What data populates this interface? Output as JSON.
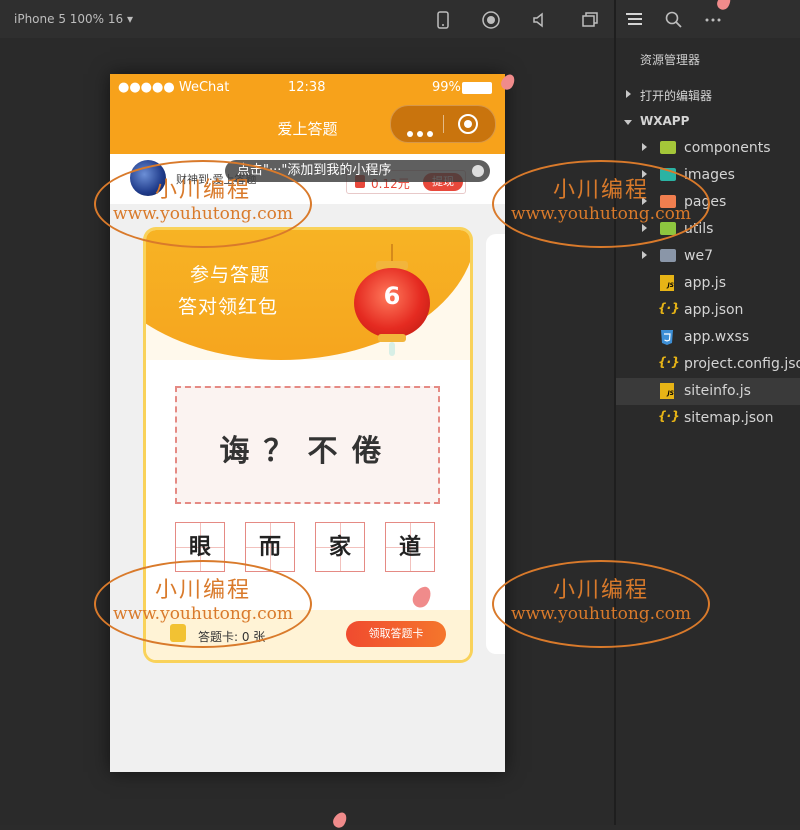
{
  "toolbar": {
    "device_label": "iPhone 5 100% 16 ▾",
    "icons": [
      "phone-icon",
      "record-icon",
      "speaker-icon",
      "window-icon",
      "list-icon",
      "search-icon",
      "more-icon"
    ]
  },
  "phone": {
    "status": {
      "carrier": "●●●●● WeChat",
      "time": "12:38",
      "battery": "99%"
    },
    "nav_title": "爱上答题",
    "add_tip": "点击\"···\"添加到我的小程序",
    "user": {
      "name": "财神到·爱上答题",
      "money": "0.12元",
      "withdraw": "提现"
    },
    "card": {
      "line1": "参与答题",
      "line2": "答对领红包",
      "lantern_number": "6",
      "idiom": "诲？不倦",
      "choices": [
        "眼",
        "而",
        "家",
        "道"
      ],
      "ticket_label": "答题卡: 0 张",
      "ticket_button": "领取答题卡"
    },
    "colors": {
      "theme": "#f7a21b",
      "accent_red": "#e8483b"
    }
  },
  "explorer": {
    "title": "资源管理器",
    "open_editors": "打开的编辑器",
    "project": "WXAPP",
    "items": [
      {
        "label": "components",
        "type": "folder",
        "color": "#a4c639"
      },
      {
        "label": "images",
        "type": "folder",
        "color": "#2bb3a3"
      },
      {
        "label": "pages",
        "type": "folder",
        "color": "#f07e4f"
      },
      {
        "label": "utils",
        "type": "folder",
        "color": "#8dc63f"
      },
      {
        "label": "we7",
        "type": "folder",
        "color": "#8a96a8"
      },
      {
        "label": "app.js",
        "type": "js"
      },
      {
        "label": "app.json",
        "type": "json"
      },
      {
        "label": "app.wxss",
        "type": "css"
      },
      {
        "label": "project.config.json",
        "type": "json"
      },
      {
        "label": "siteinfo.js",
        "type": "js",
        "selected": true
      },
      {
        "label": "sitemap.json",
        "type": "json"
      }
    ]
  },
  "watermark": {
    "line1": "小川编程",
    "line2": "www.youhutong.com"
  }
}
